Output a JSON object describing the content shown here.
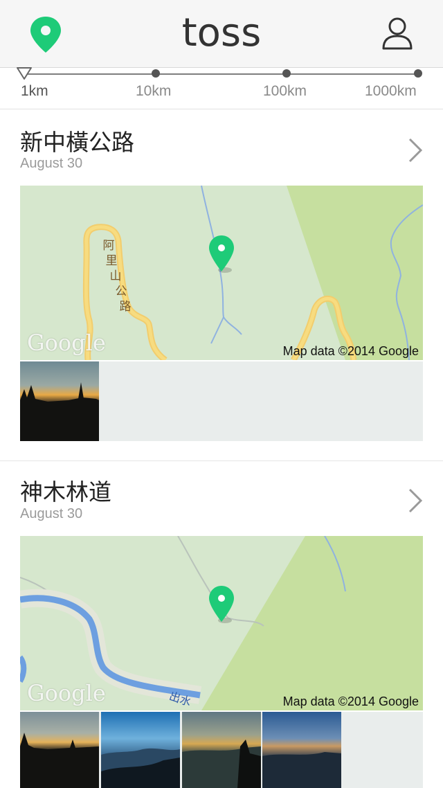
{
  "header": {
    "location_icon": "map-pin-icon",
    "logo_text": "toss",
    "profile_icon": "user-icon",
    "accent": "#1ecb78"
  },
  "slider": {
    "labels": [
      "1km",
      "10km",
      "100km",
      "1000km"
    ],
    "selected": "1km"
  },
  "posts": [
    {
      "title": "新中橫公路",
      "date": "August 30",
      "map_attribution": "Map data ©2014 Google",
      "map_logo": "Google",
      "road_label": "阿里山公路",
      "photo_count": 1
    },
    {
      "title": "神木林道",
      "date": "August 30",
      "map_attribution": "Map data ©2014 Google",
      "map_logo": "Google",
      "river_label": "出水",
      "photo_count": 4
    }
  ]
}
